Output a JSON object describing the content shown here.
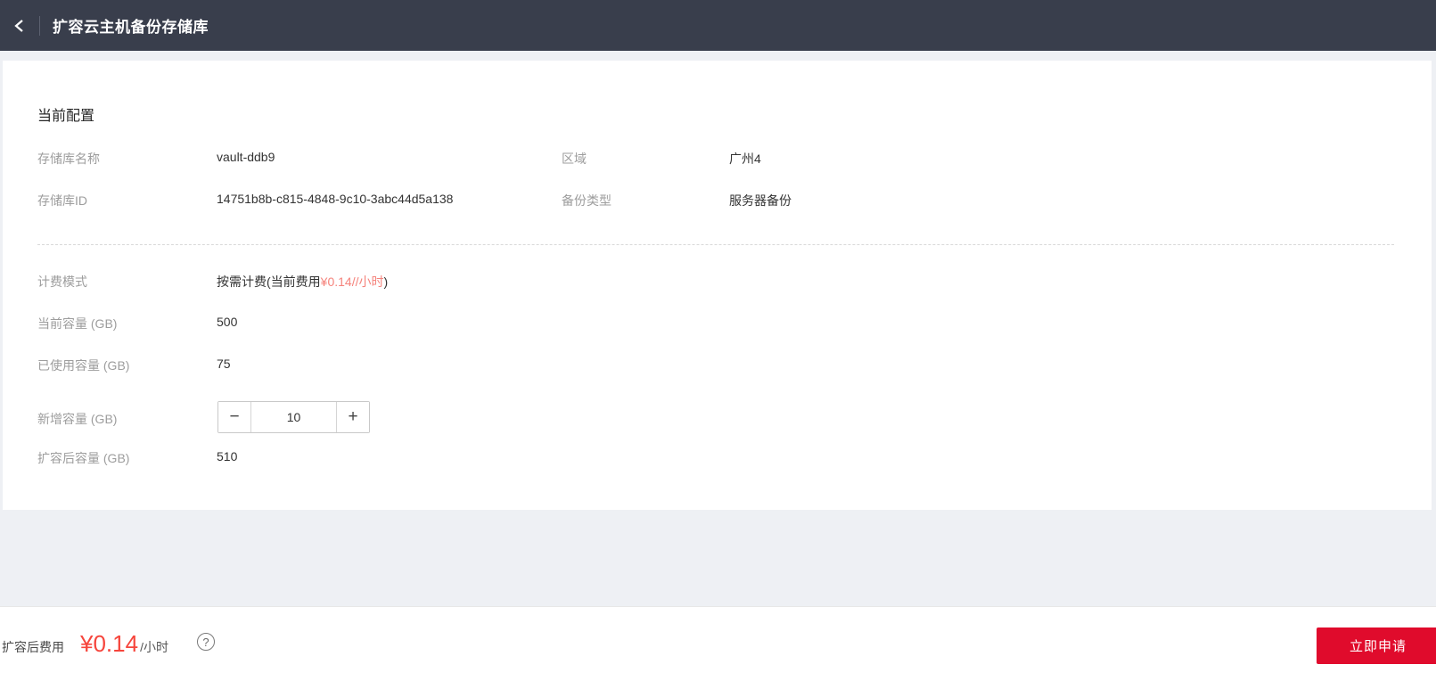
{
  "header": {
    "title": "扩容云主机备份存储库"
  },
  "config": {
    "section_title": "当前配置",
    "vault_name": {
      "label": "存储库名称",
      "value": "vault-ddb9"
    },
    "region": {
      "label": "区域",
      "value": "广州4"
    },
    "vault_id": {
      "label": "存储库ID",
      "value": "14751b8b-c815-4848-9c10-3abc44d5a138"
    },
    "backup_type": {
      "label": "备份类型",
      "value": "服务器备份"
    },
    "billing_mode": {
      "label": "计费模式",
      "text_prefix": "按需计费(当前费用",
      "price": "¥0.14//小时",
      "text_suffix": ")"
    },
    "current_capacity": {
      "label": "当前容量 (GB)",
      "value": "500"
    },
    "used_capacity": {
      "label": "已使用容量 (GB)",
      "value": "75"
    },
    "added_capacity": {
      "label": "新增容量 (GB)",
      "value": "10",
      "minus_glyph": "−",
      "plus_glyph": "+"
    },
    "capacity_after": {
      "label": "扩容后容量 (GB)",
      "value": "510"
    }
  },
  "footer": {
    "cost_label": "扩容后费用",
    "price": "¥0.14",
    "unit": "/小时",
    "help_glyph": "?",
    "submit_label": "立即申请"
  },
  "colors": {
    "topbar_bg": "#393e4c",
    "page_bg": "#eef0f4",
    "inline_price_red": "#f5837c",
    "footer_price_red": "#f6453c",
    "button_red": "#e00b2c",
    "label_gray": "#9d9d9d",
    "value_dark": "#333333"
  }
}
